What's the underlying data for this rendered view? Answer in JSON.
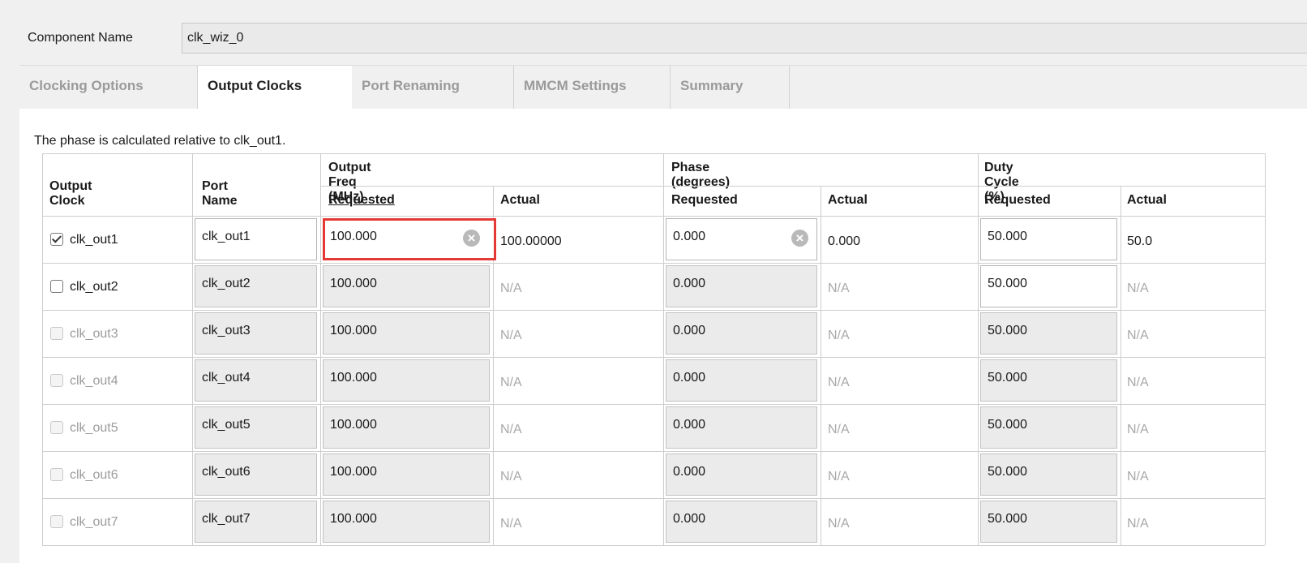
{
  "component": {
    "label": "Component Name",
    "value": "clk_wiz_0"
  },
  "tabs": [
    {
      "label": "Clocking Options",
      "active": false
    },
    {
      "label": "Output Clocks",
      "active": true
    },
    {
      "label": "Port Renaming",
      "active": false
    },
    {
      "label": "MMCM Settings",
      "active": false
    },
    {
      "label": "Summary",
      "active": false
    }
  ],
  "note": "The phase is calculated relative to clk_out1.",
  "table": {
    "headers": {
      "output_clock": "Output Clock",
      "port_name": "Port Name",
      "freq_group": "Output Freq (MHz)",
      "phase_group": "Phase (degrees)",
      "duty_group": "Duty Cycle (%)",
      "requested": "Requested",
      "actual": "Actual"
    },
    "rows": [
      {
        "clock": "clk_out1",
        "checked": true,
        "enabled": true,
        "port": "clk_out1",
        "freq_req": "100.000",
        "freq_act": "100.00000",
        "phase_req": "0.000",
        "phase_act": "0.000",
        "duty_req": "50.000",
        "duty_act": "50.0"
      },
      {
        "clock": "clk_out2",
        "checked": false,
        "enabled": true,
        "port": "clk_out2",
        "freq_req": "100.000",
        "freq_act": "N/A",
        "phase_req": "0.000",
        "phase_act": "N/A",
        "duty_req": "50.000",
        "duty_act": "N/A"
      },
      {
        "clock": "clk_out3",
        "checked": false,
        "enabled": false,
        "port": "clk_out3",
        "freq_req": "100.000",
        "freq_act": "N/A",
        "phase_req": "0.000",
        "phase_act": "N/A",
        "duty_req": "50.000",
        "duty_act": "N/A"
      },
      {
        "clock": "clk_out4",
        "checked": false,
        "enabled": false,
        "port": "clk_out4",
        "freq_req": "100.000",
        "freq_act": "N/A",
        "phase_req": "0.000",
        "phase_act": "N/A",
        "duty_req": "50.000",
        "duty_act": "N/A"
      },
      {
        "clock": "clk_out5",
        "checked": false,
        "enabled": false,
        "port": "clk_out5",
        "freq_req": "100.000",
        "freq_act": "N/A",
        "phase_req": "0.000",
        "phase_act": "N/A",
        "duty_req": "50.000",
        "duty_act": "N/A"
      },
      {
        "clock": "clk_out6",
        "checked": false,
        "enabled": false,
        "port": "clk_out6",
        "freq_req": "100.000",
        "freq_act": "N/A",
        "phase_req": "0.000",
        "phase_act": "N/A",
        "duty_req": "50.000",
        "duty_act": "N/A"
      },
      {
        "clock": "clk_out7",
        "checked": false,
        "enabled": false,
        "port": "clk_out7",
        "freq_req": "100.000",
        "freq_act": "N/A",
        "phase_req": "0.000",
        "phase_act": "N/A",
        "duty_req": "50.000",
        "duty_act": "N/A"
      }
    ]
  },
  "icons": {
    "clear": "clear-circle-icon",
    "check": "checkmark-icon"
  },
  "colors": {
    "highlight": "#e53935",
    "disabled_text": "#a9a9a9"
  }
}
